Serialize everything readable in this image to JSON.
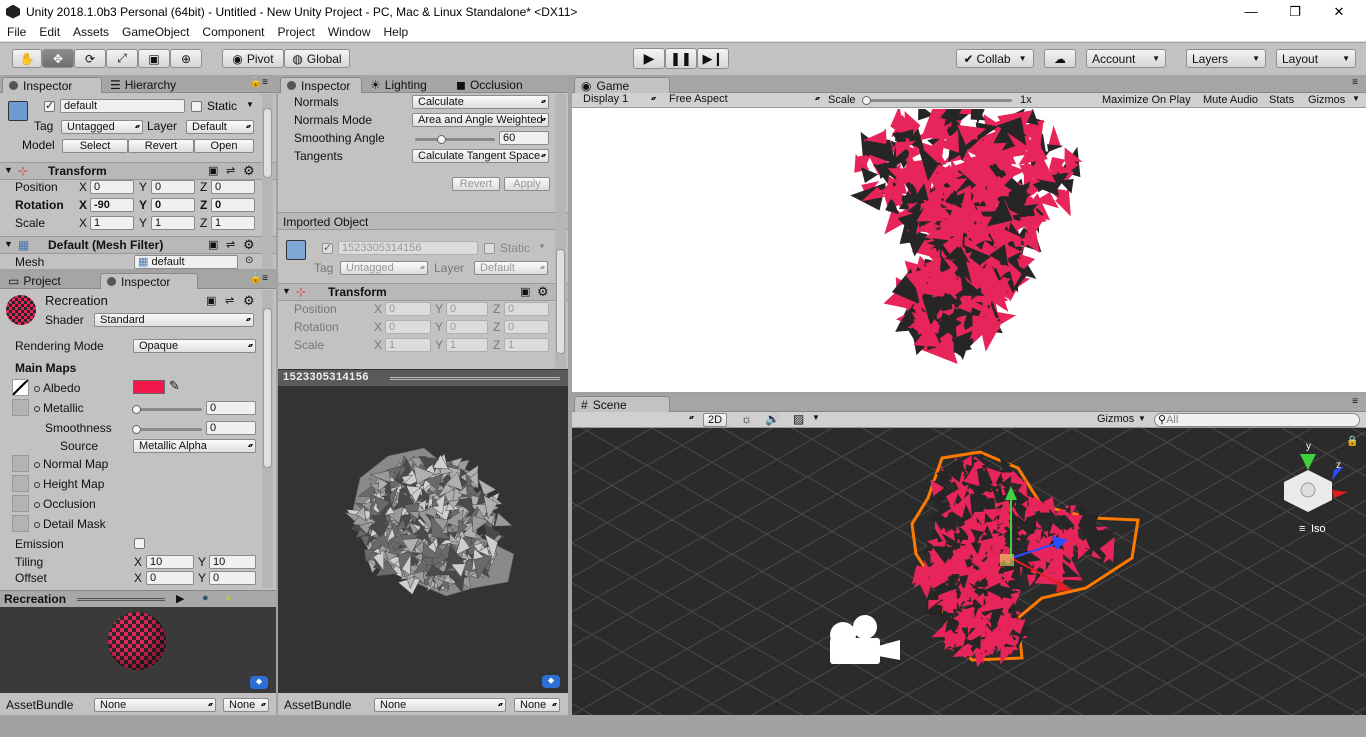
{
  "window": {
    "title": "Unity 2018.1.0b3 Personal (64bit) - Untitled - New Unity Project - PC, Mac & Linux Standalone* <DX11>",
    "controls": [
      "—",
      "❐",
      "✕"
    ]
  },
  "menu": [
    "File",
    "Edit",
    "Assets",
    "GameObject",
    "Component",
    "Project",
    "Window",
    "Help"
  ],
  "toolbar": {
    "pivot": "Pivot",
    "global": "Global",
    "collab": "Collab",
    "account": "Account",
    "layers": "Layers",
    "layout": "Layout"
  },
  "left_inspector": {
    "tabs": [
      "Inspector",
      "Hierarchy"
    ],
    "object_name": "default",
    "static_label": "Static",
    "tag_label": "Tag",
    "tag_value": "Untagged",
    "layer_label": "Layer",
    "layer_value": "Default",
    "model_label": "Model",
    "select": "Select",
    "revert": "Revert",
    "open": "Open",
    "transform_title": "Transform",
    "position_label": "Position",
    "rotation_label": "Rotation",
    "scale_label": "Scale",
    "position": {
      "x": "0",
      "y": "0",
      "z": "0"
    },
    "rotation": {
      "x": "-90",
      "y": "0",
      "z": "0"
    },
    "scale": {
      "x": "1",
      "y": "1",
      "z": "1"
    },
    "mesh_filter_title": "Default (Mesh Filter)",
    "mesh_label": "Mesh",
    "mesh_value": "default"
  },
  "material_inspector": {
    "tabs": [
      "Project",
      "Inspector"
    ],
    "material_name": "Recreation",
    "shader_label": "Shader",
    "shader_value": "Standard",
    "rendering_mode_label": "Rendering Mode",
    "rendering_mode_value": "Opaque",
    "main_maps": "Main Maps",
    "albedo": "Albedo",
    "albedo_color": "#f0174a",
    "metallic": "Metallic",
    "metallic_value": "0",
    "smoothness": "Smoothness",
    "smoothness_value": "0",
    "source_label": "Source",
    "source_value": "Metallic Alpha",
    "normal_map": "Normal Map",
    "height_map": "Height Map",
    "occlusion": "Occlusion",
    "detail_mask": "Detail Mask",
    "emission": "Emission",
    "tiling_label": "Tiling",
    "tiling": {
      "x": "10",
      "y": "10"
    },
    "offset_label": "Offset",
    "offset": {
      "x": "0",
      "y": "0"
    },
    "preview_title": "Recreation",
    "assetbundle_label": "AssetBundle",
    "assetbundle_value": "None",
    "assetbundle_variant": "None"
  },
  "import_inspector": {
    "tabs": [
      "Inspector",
      "Lighting",
      "Occlusion"
    ],
    "normals_label": "Normals",
    "normals_value": "Calculate",
    "normals_mode_label": "Normals Mode",
    "normals_mode_value": "Area and Angle Weighted",
    "smoothing_label": "Smoothing Angle",
    "smoothing_value": "60",
    "smoothing_fraction": 0.33,
    "tangents_label": "Tangents",
    "tangents_value": "Calculate Tangent Space",
    "revert": "Revert",
    "apply": "Apply",
    "imported_object": "Imported Object",
    "object_name": "1523305314156",
    "static_label": "Static",
    "tag_label": "Tag",
    "tag_value": "Untagged",
    "layer_label": "Layer",
    "layer_value": "Default",
    "transform_title": "Transform",
    "position_label": "Position",
    "rotation_label": "Rotation",
    "scale_label": "Scale",
    "position": {
      "x": "0",
      "y": "0",
      "z": "0"
    },
    "rotation": {
      "x": "0",
      "y": "0",
      "z": "0"
    },
    "scale": {
      "x": "1",
      "y": "1",
      "z": "1"
    },
    "preview_title": "1523305314156",
    "assetbundle_label": "AssetBundle",
    "assetbundle_value": "None",
    "assetbundle_variant": "None"
  },
  "game_view": {
    "tab": "Game",
    "display": "Display 1",
    "aspect": "Free Aspect",
    "scale_label": "Scale",
    "scale_value": "1x",
    "maximize": "Maximize On Play",
    "mute": "Mute Audio",
    "stats": "Stats",
    "gizmos": "Gizmos"
  },
  "scene_view": {
    "tab": "Scene",
    "mode_2d": "2D",
    "gizmos": "Gizmos",
    "search_placeholder": "All",
    "iso": "Iso",
    "axis_y": "y",
    "axis_z": "z"
  },
  "colors": {
    "mesh_pink": "#e8255a",
    "mesh_dark": "#262626",
    "selection_outline": "#ff7a00"
  }
}
